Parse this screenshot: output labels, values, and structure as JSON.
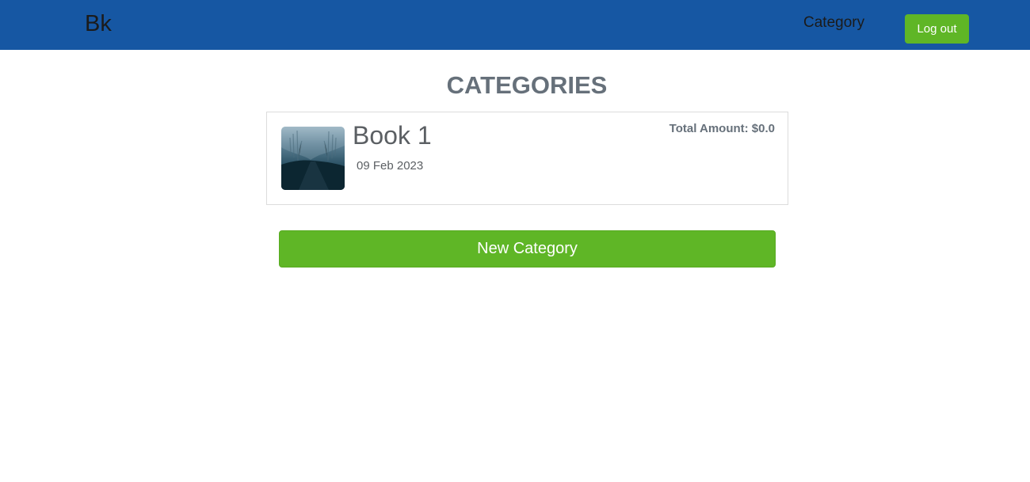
{
  "navbar": {
    "brand": "Bk",
    "links": [
      "Category"
    ],
    "logout_label": "Log out",
    "background_color": "#1657a3",
    "button_color": "#5fb626"
  },
  "page": {
    "title": "CATEGORIES"
  },
  "categories": [
    {
      "name": "Book 1",
      "date": "09 Feb 2023",
      "total": "Total Amount: $0.0",
      "thumbnail_icon": "foggy-forest-road-photo"
    }
  ],
  "actions": {
    "new_category_label": "New Category"
  }
}
